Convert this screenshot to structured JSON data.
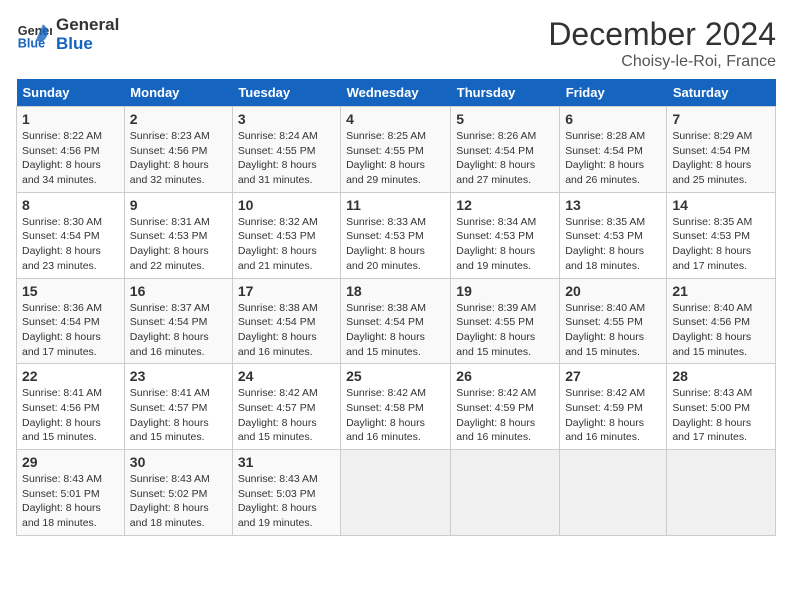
{
  "header": {
    "logo_line1": "General",
    "logo_line2": "Blue",
    "title": "December 2024",
    "subtitle": "Choisy-le-Roi, France"
  },
  "columns": [
    "Sunday",
    "Monday",
    "Tuesday",
    "Wednesday",
    "Thursday",
    "Friday",
    "Saturday"
  ],
  "weeks": [
    [
      {
        "day": "1",
        "info": "Sunrise: 8:22 AM\nSunset: 4:56 PM\nDaylight: 8 hours\nand 34 minutes."
      },
      {
        "day": "2",
        "info": "Sunrise: 8:23 AM\nSunset: 4:56 PM\nDaylight: 8 hours\nand 32 minutes."
      },
      {
        "day": "3",
        "info": "Sunrise: 8:24 AM\nSunset: 4:55 PM\nDaylight: 8 hours\nand 31 minutes."
      },
      {
        "day": "4",
        "info": "Sunrise: 8:25 AM\nSunset: 4:55 PM\nDaylight: 8 hours\nand 29 minutes."
      },
      {
        "day": "5",
        "info": "Sunrise: 8:26 AM\nSunset: 4:54 PM\nDaylight: 8 hours\nand 27 minutes."
      },
      {
        "day": "6",
        "info": "Sunrise: 8:28 AM\nSunset: 4:54 PM\nDaylight: 8 hours\nand 26 minutes."
      },
      {
        "day": "7",
        "info": "Sunrise: 8:29 AM\nSunset: 4:54 PM\nDaylight: 8 hours\nand 25 minutes."
      }
    ],
    [
      {
        "day": "8",
        "info": "Sunrise: 8:30 AM\nSunset: 4:54 PM\nDaylight: 8 hours\nand 23 minutes."
      },
      {
        "day": "9",
        "info": "Sunrise: 8:31 AM\nSunset: 4:53 PM\nDaylight: 8 hours\nand 22 minutes."
      },
      {
        "day": "10",
        "info": "Sunrise: 8:32 AM\nSunset: 4:53 PM\nDaylight: 8 hours\nand 21 minutes."
      },
      {
        "day": "11",
        "info": "Sunrise: 8:33 AM\nSunset: 4:53 PM\nDaylight: 8 hours\nand 20 minutes."
      },
      {
        "day": "12",
        "info": "Sunrise: 8:34 AM\nSunset: 4:53 PM\nDaylight: 8 hours\nand 19 minutes."
      },
      {
        "day": "13",
        "info": "Sunrise: 8:35 AM\nSunset: 4:53 PM\nDaylight: 8 hours\nand 18 minutes."
      },
      {
        "day": "14",
        "info": "Sunrise: 8:35 AM\nSunset: 4:53 PM\nDaylight: 8 hours\nand 17 minutes."
      }
    ],
    [
      {
        "day": "15",
        "info": "Sunrise: 8:36 AM\nSunset: 4:54 PM\nDaylight: 8 hours\nand 17 minutes."
      },
      {
        "day": "16",
        "info": "Sunrise: 8:37 AM\nSunset: 4:54 PM\nDaylight: 8 hours\nand 16 minutes."
      },
      {
        "day": "17",
        "info": "Sunrise: 8:38 AM\nSunset: 4:54 PM\nDaylight: 8 hours\nand 16 minutes."
      },
      {
        "day": "18",
        "info": "Sunrise: 8:38 AM\nSunset: 4:54 PM\nDaylight: 8 hours\nand 15 minutes."
      },
      {
        "day": "19",
        "info": "Sunrise: 8:39 AM\nSunset: 4:55 PM\nDaylight: 8 hours\nand 15 minutes."
      },
      {
        "day": "20",
        "info": "Sunrise: 8:40 AM\nSunset: 4:55 PM\nDaylight: 8 hours\nand 15 minutes."
      },
      {
        "day": "21",
        "info": "Sunrise: 8:40 AM\nSunset: 4:56 PM\nDaylight: 8 hours\nand 15 minutes."
      }
    ],
    [
      {
        "day": "22",
        "info": "Sunrise: 8:41 AM\nSunset: 4:56 PM\nDaylight: 8 hours\nand 15 minutes."
      },
      {
        "day": "23",
        "info": "Sunrise: 8:41 AM\nSunset: 4:57 PM\nDaylight: 8 hours\nand 15 minutes."
      },
      {
        "day": "24",
        "info": "Sunrise: 8:42 AM\nSunset: 4:57 PM\nDaylight: 8 hours\nand 15 minutes."
      },
      {
        "day": "25",
        "info": "Sunrise: 8:42 AM\nSunset: 4:58 PM\nDaylight: 8 hours\nand 16 minutes."
      },
      {
        "day": "26",
        "info": "Sunrise: 8:42 AM\nSunset: 4:59 PM\nDaylight: 8 hours\nand 16 minutes."
      },
      {
        "day": "27",
        "info": "Sunrise: 8:42 AM\nSunset: 4:59 PM\nDaylight: 8 hours\nand 16 minutes."
      },
      {
        "day": "28",
        "info": "Sunrise: 8:43 AM\nSunset: 5:00 PM\nDaylight: 8 hours\nand 17 minutes."
      }
    ],
    [
      {
        "day": "29",
        "info": "Sunrise: 8:43 AM\nSunset: 5:01 PM\nDaylight: 8 hours\nand 18 minutes."
      },
      {
        "day": "30",
        "info": "Sunrise: 8:43 AM\nSunset: 5:02 PM\nDaylight: 8 hours\nand 18 minutes."
      },
      {
        "day": "31",
        "info": "Sunrise: 8:43 AM\nSunset: 5:03 PM\nDaylight: 8 hours\nand 19 minutes."
      },
      null,
      null,
      null,
      null
    ]
  ]
}
